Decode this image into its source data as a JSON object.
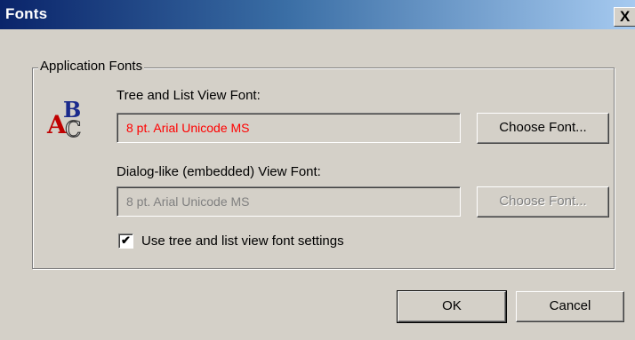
{
  "window": {
    "title": "Fonts",
    "close_label": "X"
  },
  "group": {
    "legend": "Application Fonts",
    "tree_font_label": "Tree and List View Font:",
    "tree_font_value": "8 pt. Arial Unicode MS",
    "tree_font_value_color": "#ff0000",
    "tree_choose_label": "Choose Font...",
    "dialog_font_label": "Dialog-like (embedded) View Font:",
    "dialog_font_value": "8 pt. Arial Unicode MS",
    "dialog_choose_label": "Choose Font...",
    "checkbox_label": "Use tree and list view font settings",
    "checkbox_checked": true,
    "icon": "abc-fonts-icon"
  },
  "buttons": {
    "ok_label": "OK",
    "cancel_label": "Cancel"
  }
}
